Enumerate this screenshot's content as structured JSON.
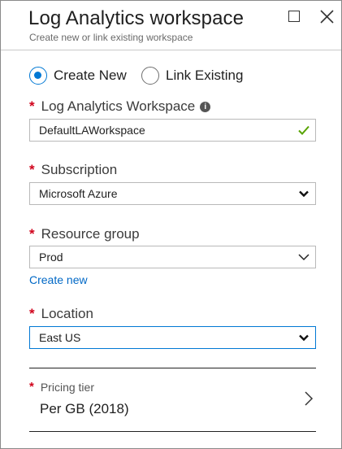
{
  "blade": {
    "title": "Log Analytics workspace",
    "subtitle": "Create new or link existing workspace"
  },
  "mode": {
    "options": [
      {
        "label": "Create New",
        "selected": true
      },
      {
        "label": "Link Existing",
        "selected": false
      }
    ]
  },
  "workspace": {
    "label": "Log Analytics Workspace",
    "required": "*",
    "value": "DefaultLAWorkspace",
    "valid_icon": "checkmark-icon"
  },
  "subscription": {
    "label": "Subscription",
    "required": "*",
    "value": "Microsoft Azure"
  },
  "resource_group": {
    "label": "Resource group",
    "required": "*",
    "value": "Prod",
    "create_new_link": "Create new"
  },
  "location": {
    "label": "Location",
    "required": "*",
    "value": "East US"
  },
  "pricing_tier": {
    "label": "Pricing tier",
    "required": "*",
    "value": "Per GB (2018)"
  },
  "colors": {
    "accent": "#0078d4",
    "required": "#d0021b",
    "link": "#0068c6",
    "valid": "#57a300"
  }
}
